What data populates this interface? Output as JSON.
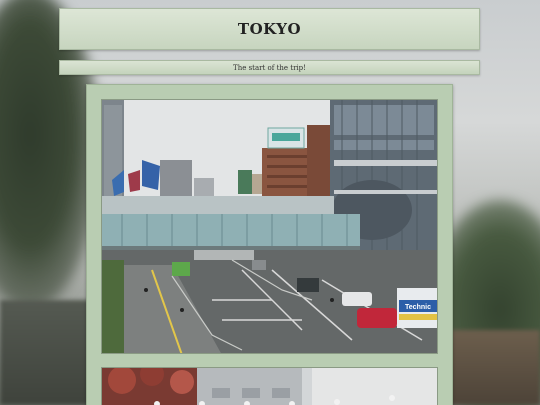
{
  "page": {
    "title": "TOKYO",
    "subtitle": "The start of the trip!"
  },
  "photos": [
    {
      "signs": {
        "billboard": "",
        "truck_label": "Technic"
      }
    },
    {}
  ]
}
